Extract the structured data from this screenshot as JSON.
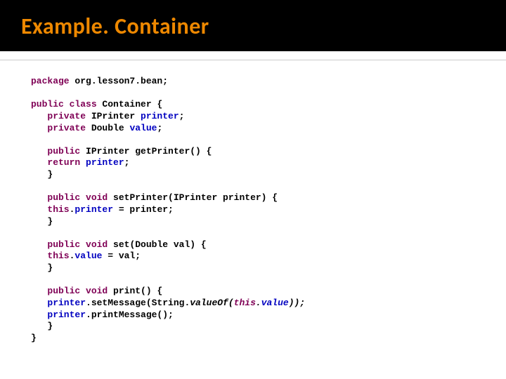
{
  "title": "Example. Container",
  "code": {
    "l1a": "package",
    "l1b": " org.lesson7.bean;",
    "l2a": "public",
    "l2b": " class",
    "l2c": " Container {",
    "l3a": "   private",
    "l3b": " IPrinter ",
    "l3c": "printer",
    "l3d": ";",
    "l4a": "   private",
    "l4b": " Double ",
    "l4c": "value",
    "l4d": ";",
    "l5a": "   public",
    "l5b": " IPrinter getPrinter() {",
    "l6a": "   return",
    "l6b": " printer",
    "l6c": ";",
    "l7": "   }",
    "l8a": "   public",
    "l8b": " void",
    "l8c": " setPrinter(IPrinter printer) {",
    "l9a": "   this",
    "l9b": ".",
    "l9c": "printer",
    "l9d": " = printer;",
    "l10": "   }",
    "l11a": "   public",
    "l11b": " void",
    "l11c": " set(Double val) {",
    "l12a": "   this",
    "l12b": ".",
    "l12c": "value",
    "l12d": " = val;",
    "l13": "   }",
    "l14a": "   public",
    "l14b": " void",
    "l14c": " print() {",
    "l15a": "   printer",
    "l15b": ".setMessage(String.",
    "l15c": "valueOf(",
    "l15d": "this",
    "l15e": ".",
    "l15f": "value",
    "l15g": "));",
    "l16a": "   printer",
    "l16b": ".printMessage();",
    "l17": "   }",
    "l18": "}"
  }
}
